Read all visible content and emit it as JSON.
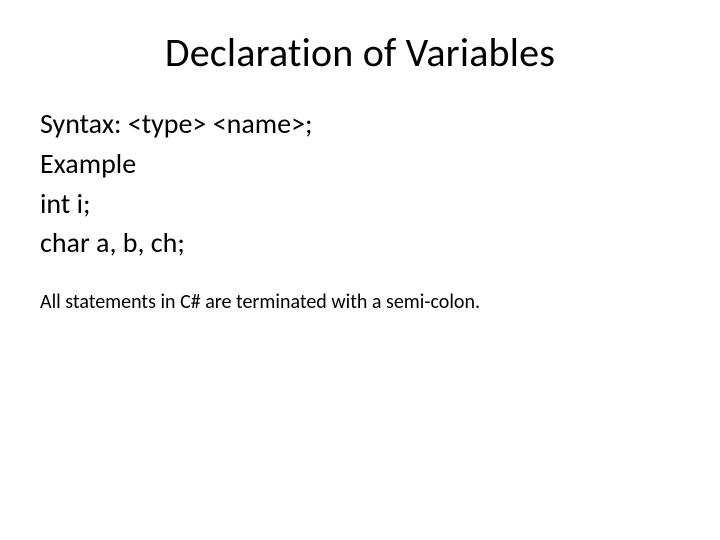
{
  "slide": {
    "title": "Declaration of Variables",
    "lines": {
      "syntax": "Syntax: <type> <name>;",
      "example_label": "Example",
      "example1": "int i;",
      "example2": "char a, b, ch;"
    },
    "footer": "All statements in C# are terminated with a semi-colon."
  }
}
